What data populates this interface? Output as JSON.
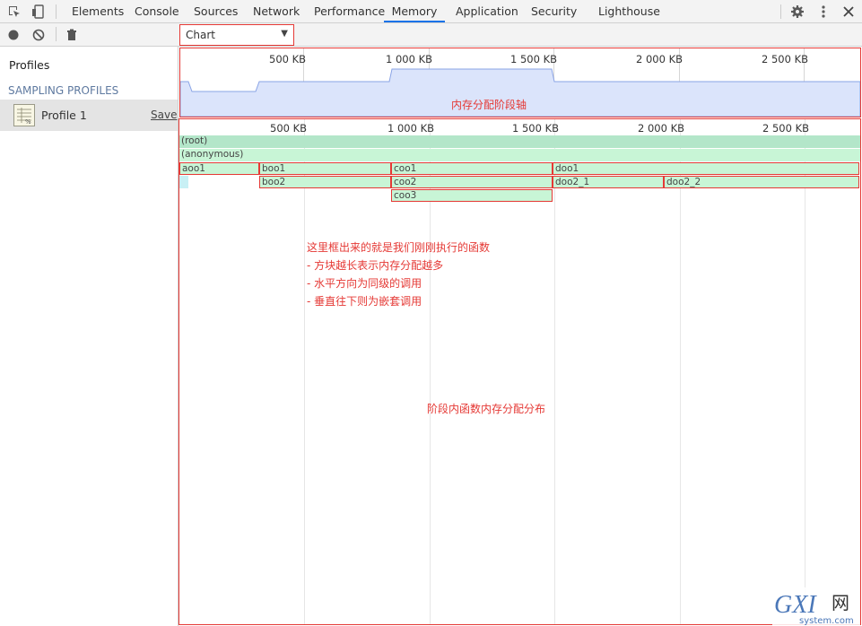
{
  "tabs": [
    "Elements",
    "Console",
    "Sources",
    "Network",
    "Performance",
    "Memory",
    "Application",
    "Security",
    "Lighthouse"
  ],
  "active_tab": "Memory",
  "sidebar": {
    "title": "Profiles",
    "section": "SAMPLING PROFILES",
    "profile_name": "Profile 1",
    "save_label": "Save"
  },
  "view_select": {
    "value": "Chart"
  },
  "axis_labels": [
    "500 KB",
    "1 000 KB",
    "1 500 KB",
    "2 000 KB",
    "2 500 KB"
  ],
  "overview": {
    "caption": "内存分配阶段轴"
  },
  "flame": {
    "frames": [
      "(root)",
      "(anonymous)",
      "aoo1",
      "boo1",
      "coo1",
      "doo1",
      "boo2",
      "coo2",
      "doo2_1",
      "doo2_2",
      "coo3"
    ],
    "notes": [
      "这里框出来的就是我们刚刚执行的函数",
      "- 方块越长表示内存分配越多",
      "- 水平方向为同级的调用",
      "- 垂直往下则为嵌套调用"
    ],
    "caption": "阶段内函数内存分配分布"
  },
  "watermark": {
    "brand": "GXI网",
    "domain": "system.com"
  },
  "colors": {
    "accent": "#1a73e8",
    "highlight": "#e53935",
    "frame_root": "#b3e6c9",
    "frame_node": "#c8f5d6"
  }
}
